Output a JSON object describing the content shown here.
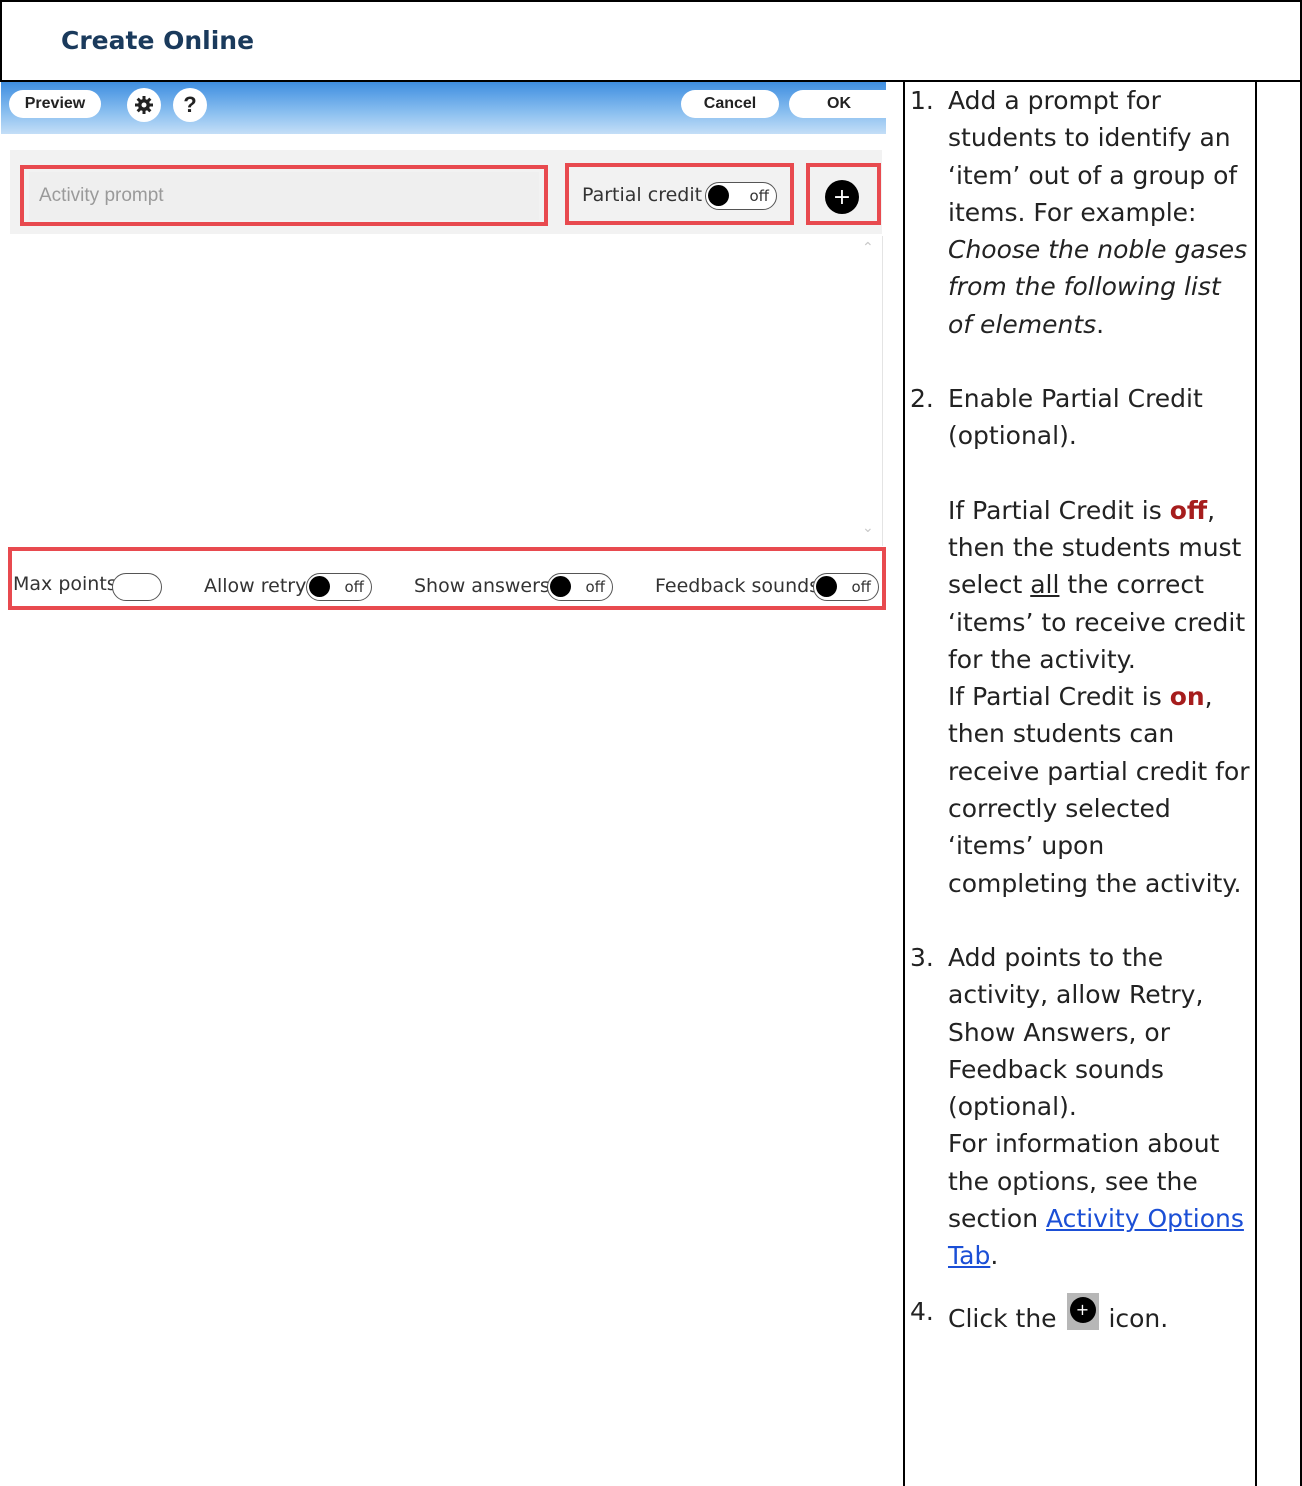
{
  "header": {
    "title": "Create Online"
  },
  "toolbar": {
    "preview_label": "Preview",
    "settings_icon": "gear-icon",
    "help_label": "?",
    "cancel_label": "Cancel",
    "ok_label": "OK"
  },
  "editor": {
    "prompt_placeholder": "Activity prompt",
    "partial_credit_label": "Partial credit",
    "partial_credit_state": "off",
    "add_label": "+"
  },
  "options": {
    "max_points_label": "Max points",
    "allow_retry_label": "Allow retry",
    "allow_retry_state": "off",
    "show_answers_label": "Show answers",
    "show_answers_state": "off",
    "feedback_sounds_label": "Feedback sounds",
    "feedback_sounds_state": "off"
  },
  "instructions": {
    "step1": {
      "num": "1.",
      "text_a": "Add a prompt for students to identify an ‘item’ out of a group of items. For example: ",
      "example": "Choose the noble gases from the following list of elements",
      "text_b": "."
    },
    "step2": {
      "num": "2.",
      "text": "Enable Partial Credit (optional).",
      "off_a": "If Partial Credit is ",
      "off_kw": "off",
      "off_b": ", then the students must select ",
      "off_all": "all",
      "off_c": " the correct ‘items’ to receive credit for the activity.",
      "on_a": "If Partial Credit is ",
      "on_kw": "on",
      "on_b": ", then students can receive partial credit for correctly selected ‘items’ upon completing the activity."
    },
    "step3": {
      "num": "3.",
      "text": "Add points to the activity, allow Retry, Show Answers, or Feedback sounds (optional).",
      "info_a": "For information about the options, see the section ",
      "link": "Activity Options Tab",
      "info_b": "."
    },
    "step4": {
      "num": "4.",
      "text_a": "Click the ",
      "text_b": " icon."
    }
  }
}
